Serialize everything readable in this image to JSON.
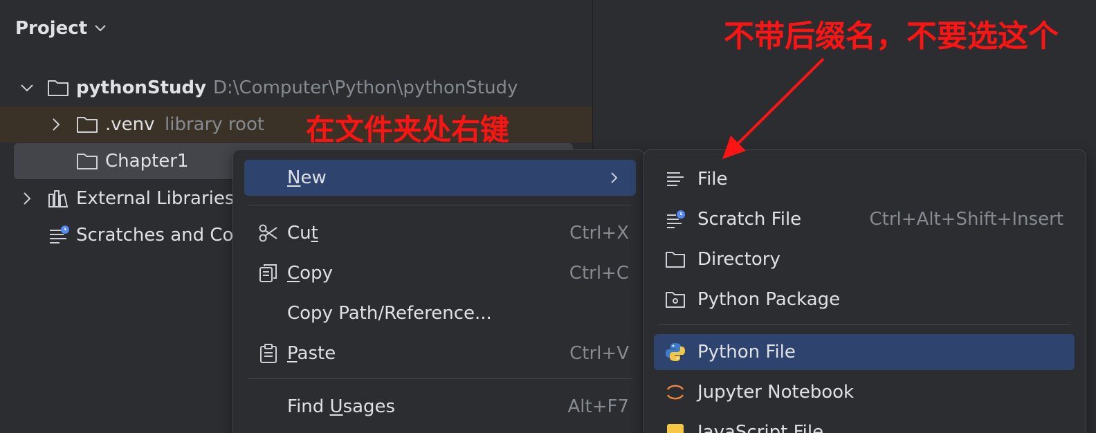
{
  "project": {
    "header": "Project",
    "tree": [
      {
        "name": "pythonStudy",
        "hint": "D:\\Computer\\Python\\pythonStudy"
      },
      {
        "name": ".venv",
        "hint": "library root"
      },
      {
        "name": "Chapter1"
      },
      {
        "name": "External Libraries"
      },
      {
        "name": "Scratches and Co"
      }
    ]
  },
  "annotations": {
    "folder_hint": "在文件夹处右键",
    "file_hint": "不带后缀名，不要选这个"
  },
  "context_menu": {
    "new": {
      "before": "",
      "mnemonic": "N",
      "after": "ew"
    },
    "cut": {
      "before": "Cu",
      "mnemonic": "t",
      "after": "",
      "shortcut": "Ctrl+X"
    },
    "copy": {
      "before": "",
      "mnemonic": "C",
      "after": "opy",
      "shortcut": "Ctrl+C"
    },
    "copy_path": {
      "label": "Copy Path/Reference..."
    },
    "paste": {
      "before": "",
      "mnemonic": "P",
      "after": "aste",
      "shortcut": "Ctrl+V"
    },
    "find_usages": {
      "before": "Find ",
      "mnemonic": "U",
      "after": "sages",
      "shortcut": "Alt+F7"
    }
  },
  "new_submenu": {
    "file": "File",
    "scratch_file": "Scratch File",
    "scratch_shortcut": "Ctrl+Alt+Shift+Insert",
    "directory": "Directory",
    "python_package": "Python Package",
    "python_file": "Python File",
    "jupyter_notebook": "Jupyter Notebook",
    "javascript_file": "JavaScript File"
  },
  "colors": {
    "annotation": "#ff1414",
    "selection": "#2e436e",
    "venv_highlight": "#3b3227"
  }
}
